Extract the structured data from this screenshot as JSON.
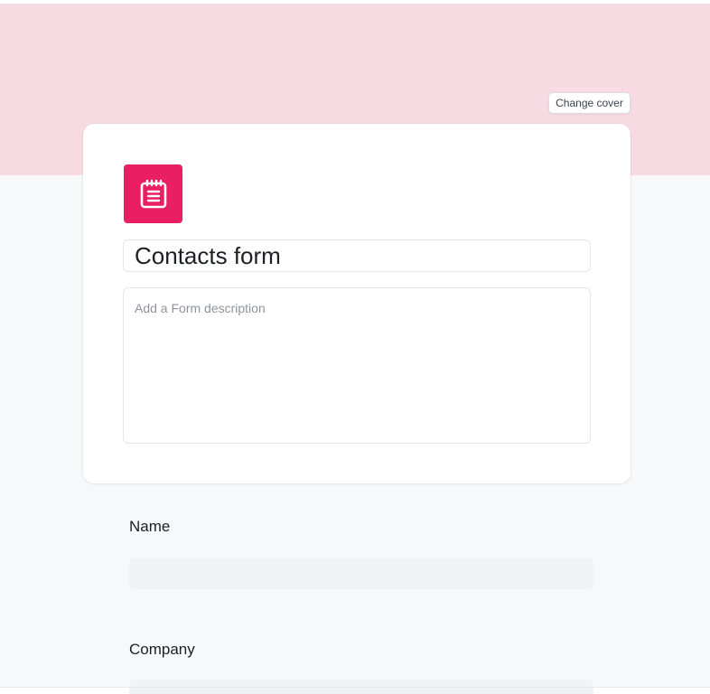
{
  "colors": {
    "cover": "#f8dbe2",
    "accent": "#e91e63",
    "canvas": "#f7f8fa"
  },
  "cover": {
    "change_cover_label": "Change cover"
  },
  "form": {
    "icon": "notepad-icon",
    "title": "Contacts form",
    "description_placeholder": "Add a Form description",
    "description_value": ""
  },
  "fields": [
    {
      "label": "Name",
      "value": ""
    },
    {
      "label": "Company",
      "value": ""
    }
  ]
}
